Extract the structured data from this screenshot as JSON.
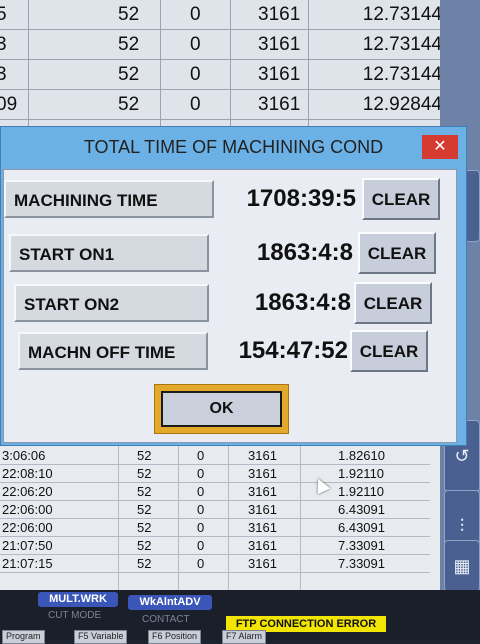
{
  "background_table": {
    "top_rows": [
      [
        "5",
        "52",
        "0",
        "3161",
        "12.73144"
      ],
      [
        "3",
        "52",
        "0",
        "3161",
        "12.73144"
      ],
      [
        "3",
        "52",
        "0",
        "3161",
        "12.73144"
      ],
      [
        "09",
        "52",
        "0",
        "3161",
        "12.92844"
      ]
    ],
    "lower_rows": [
      [
        "3:06:06",
        "52",
        "0",
        "3161",
        "1.82610"
      ],
      [
        "22:08:10",
        "52",
        "0",
        "3161",
        "1.92110"
      ],
      [
        "22:06:20",
        "52",
        "0",
        "3161",
        "1.92110"
      ],
      [
        "22:06:00",
        "52",
        "0",
        "3161",
        "6.43091"
      ],
      [
        "22:06:00",
        "52",
        "0",
        "3161",
        "6.43091"
      ],
      [
        "21:07:50",
        "52",
        "0",
        "3161",
        "7.33091"
      ],
      [
        "21:07:15",
        "52",
        "0",
        "3161",
        "7.33091"
      ]
    ],
    "left_strip": [
      "8",
      "3",
      "3"
    ]
  },
  "dialog": {
    "title": "TOTAL TIME OF MACHINING COND",
    "close_glyph": "✕",
    "items": [
      {
        "label": "MACHINING TIME",
        "value": "1708:39:5",
        "button": "CLEAR"
      },
      {
        "label": "START ON1",
        "value": "1863:4:8",
        "button": "CLEAR"
      },
      {
        "label": "START ON2",
        "value": "1863:4:8",
        "button": "CLEAR"
      },
      {
        "label": "MACHN OFF TIME",
        "value": "154:47:52",
        "button": "CLEAR"
      }
    ],
    "ok_label": "OK"
  },
  "bottom_bar": {
    "mult_wrk": "MULT.WRK",
    "wk_alnt_adv": "WkAlntADV",
    "cut_mode": "CUT MODE",
    "contact": "CONTACT",
    "ftp_error": "FTP CONNECTION ERROR",
    "fkeys": [
      "Program",
      "F5 Variable",
      "F6 Position",
      "F7 Alarm"
    ]
  },
  "right_panel": {
    "icons": [
      "arrow-right-icon",
      "hook-icon",
      "slider-icon",
      "keypad-icon"
    ]
  },
  "colors": {
    "dialog_frame": "#6bb1e6",
    "close_button": "#d53b31",
    "ok_frame": "#e2a92a",
    "error_bar": "#f2e600"
  }
}
